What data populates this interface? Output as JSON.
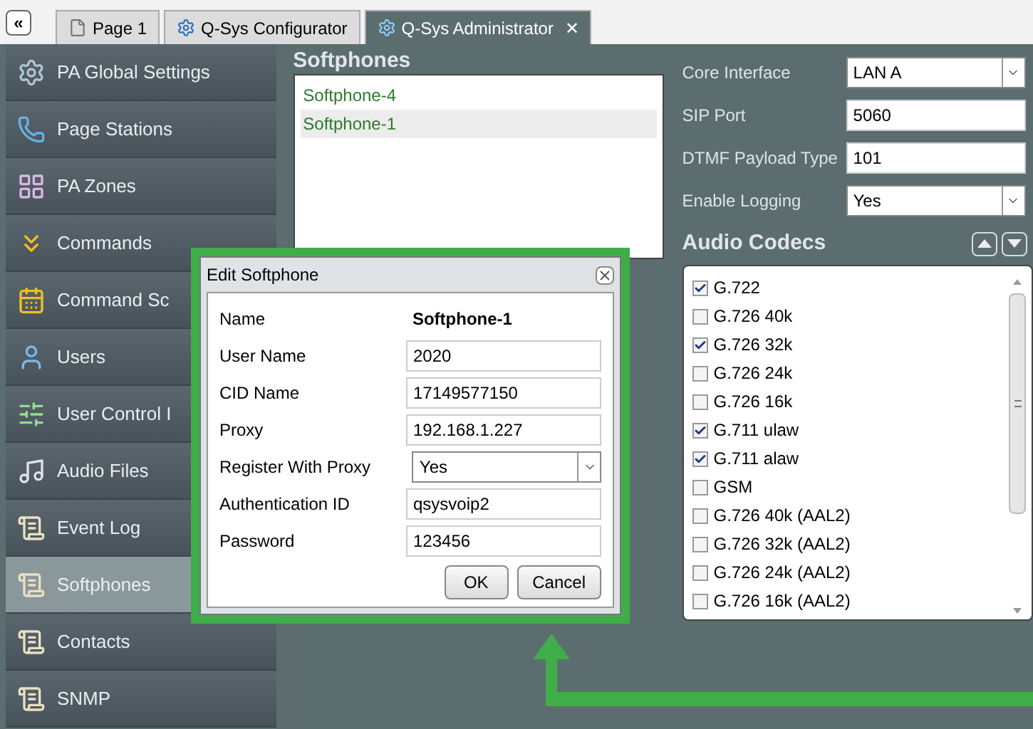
{
  "tab_bar": {
    "collapse_button": "«",
    "tabs": [
      {
        "label": "Page 1",
        "selected": false,
        "closable": false
      },
      {
        "label": "Q-Sys Configurator",
        "selected": false,
        "closable": false
      },
      {
        "label": "Q-Sys Administrator",
        "selected": true,
        "closable": true,
        "close": "✕"
      }
    ]
  },
  "sidebar": {
    "items": [
      {
        "label": "PA Global Settings",
        "selected": false
      },
      {
        "label": "Page Stations",
        "selected": false
      },
      {
        "label": "PA Zones",
        "selected": false
      },
      {
        "label": "Commands",
        "selected": false
      },
      {
        "label": "Command Sc",
        "selected": false
      },
      {
        "label": "Users",
        "selected": false
      },
      {
        "label": "User Control I",
        "selected": false
      },
      {
        "label": "Audio Files",
        "selected": false
      },
      {
        "label": "Event Log",
        "selected": false
      },
      {
        "label": "Softphones",
        "selected": true
      },
      {
        "label": "Contacts",
        "selected": false
      },
      {
        "label": "SNMP",
        "selected": false
      }
    ]
  },
  "softphones": {
    "title": "Softphones",
    "items": [
      {
        "label": "Softphone-4",
        "selected": false
      },
      {
        "label": "Softphone-1",
        "selected": true
      }
    ]
  },
  "settings": [
    {
      "label": "Core Interface",
      "kind": "select",
      "value": "LAN A"
    },
    {
      "label": "SIP Port",
      "kind": "input",
      "value": "5060"
    },
    {
      "label": "DTMF Payload Type",
      "kind": "input",
      "value": "101"
    },
    {
      "label": "Enable Logging",
      "kind": "select",
      "value": "Yes"
    }
  ],
  "audio_codecs": {
    "title": "Audio Codecs",
    "items": [
      {
        "label": "G.722",
        "checked": true
      },
      {
        "label": "G.726 40k",
        "checked": false
      },
      {
        "label": "G.726 32k",
        "checked": true
      },
      {
        "label": "G.726 24k",
        "checked": false
      },
      {
        "label": "G.726 16k",
        "checked": false
      },
      {
        "label": "G.711 ulaw",
        "checked": true
      },
      {
        "label": "G.711 alaw",
        "checked": true
      },
      {
        "label": "GSM",
        "checked": false
      },
      {
        "label": "G.726 40k (AAL2)",
        "checked": false
      },
      {
        "label": "G.726 32k (AAL2)",
        "checked": false
      },
      {
        "label": "G.726 24k (AAL2)",
        "checked": false
      },
      {
        "label": "G.726 16k (AAL2)",
        "checked": false
      }
    ]
  },
  "dialog": {
    "title": "Edit Softphone",
    "fields": [
      {
        "label": "Name",
        "kind": "text",
        "value": "Softphone-1"
      },
      {
        "label": "User Name",
        "kind": "input",
        "value": "2020"
      },
      {
        "label": "CID Name",
        "kind": "input",
        "value": "17149577150"
      },
      {
        "label": "Proxy",
        "kind": "input",
        "value": "192.168.1.227"
      },
      {
        "label": "Register With Proxy",
        "kind": "select",
        "value": "Yes"
      },
      {
        "label": "Authentication ID",
        "kind": "input",
        "value": "qsysvoip2"
      },
      {
        "label": "Password",
        "kind": "input",
        "value": "123456"
      }
    ],
    "buttons": [
      "OK",
      "Cancel"
    ]
  }
}
